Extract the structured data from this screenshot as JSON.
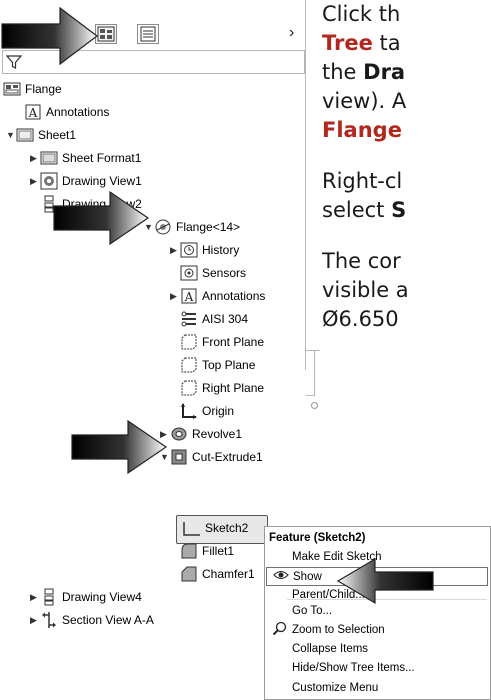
{
  "instructions": {
    "line1_a": "Click th",
    "line2_b": "Tree",
    "line2_a": " ta",
    "line3_a": "the ",
    "line3_b": "Dra",
    "line4_a": "view). A",
    "line5_b": "Flange",
    "line6_a": "Right-cl",
    "line7_a": "select ",
    "line7_b": "S",
    "line8_a": "The cor",
    "line9_a": "visible a",
    "line10_a": "Ø6.650"
  },
  "tree": {
    "root": "Flange",
    "annotations": "Annotations",
    "sheet": "Sheet1",
    "sheet_format": "Sheet Format1",
    "dv1": "Drawing View1",
    "dv2": "Drawing View2",
    "part": "Flange<14>",
    "history": "History",
    "sensors": "Sensors",
    "part_annotations": "Annotations",
    "material": "AISI 304",
    "front_plane": "Front Plane",
    "top_plane": "Top Plane",
    "right_plane": "Right Plane",
    "origin": "Origin",
    "revolve": "Revolve1",
    "cut_extrude": "Cut-Extrude1",
    "sketch": "Sketch2",
    "fillet": "Fillet1",
    "chamfer": "Chamfer1",
    "dv4": "Drawing View4",
    "section": "Section View A-A"
  },
  "menu": {
    "title": "Feature (Sketch2)",
    "make_edit": "Make Edit Sketch",
    "show": "Show",
    "parent_child": "Parent/Child...",
    "go_to": "Go To...",
    "zoom": "Zoom to Selection",
    "collapse": "Collapse Items",
    "hide_show": "Hide/Show Tree Items...",
    "customize": "Customize Menu"
  },
  "colors": {
    "highlight": "#b0281e"
  }
}
